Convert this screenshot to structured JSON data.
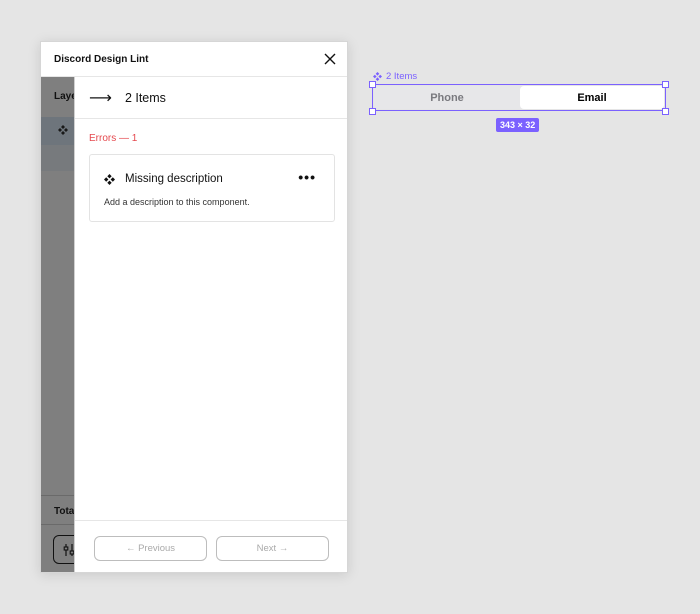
{
  "plugin": {
    "title": "Discord Design Lint",
    "background": {
      "layers_label": "Laye",
      "total_label": "Tota"
    },
    "panel": {
      "items_count": "2 Items",
      "errors_label": "Errors — 1",
      "error": {
        "title": "Missing description",
        "description": "Add a description to this component.",
        "more_label": "•••"
      },
      "previous_label": "← Previous",
      "next_label": "Next →"
    }
  },
  "canvas": {
    "component_name": "2 Items",
    "segmented_control": {
      "options": [
        "Phone",
        "Email"
      ],
      "selected": "Email"
    },
    "dimensions": "343 × 32"
  },
  "colors": {
    "error": "#e5484d",
    "selection": "#7b61ff"
  }
}
